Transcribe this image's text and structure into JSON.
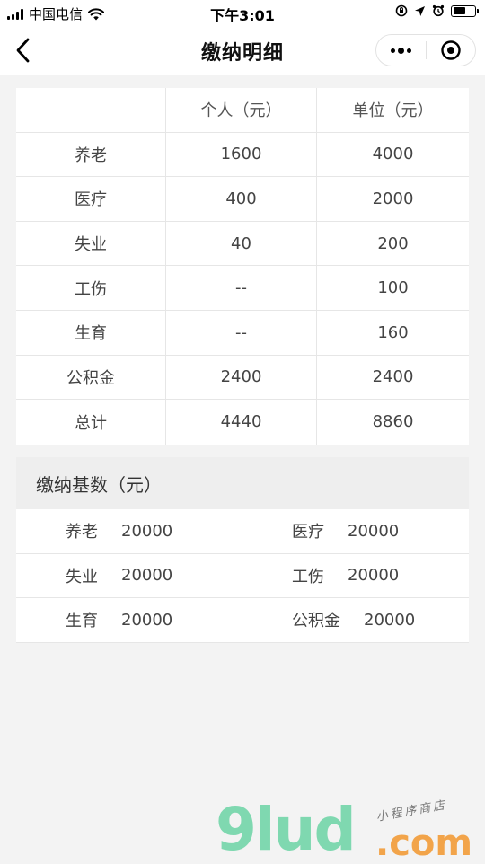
{
  "status_bar": {
    "carrier": "中国电信",
    "time": "下午3:01",
    "battery_level": 0.6
  },
  "nav": {
    "title": "缴纳明细"
  },
  "detail_table": {
    "headers": [
      "",
      "个人（元）",
      "单位（元）"
    ],
    "rows": [
      {
        "item": "养老",
        "personal": "1600",
        "company": "4000"
      },
      {
        "item": "医疗",
        "personal": "400",
        "company": "2000"
      },
      {
        "item": "失业",
        "personal": "40",
        "company": "200"
      },
      {
        "item": "工伤",
        "personal": "--",
        "company": "100"
      },
      {
        "item": "生育",
        "personal": "--",
        "company": "160"
      },
      {
        "item": "公积金",
        "personal": "2400",
        "company": "2400"
      },
      {
        "item": "总计",
        "personal": "4440",
        "company": "8860"
      }
    ]
  },
  "base": {
    "title": "缴纳基数（元）",
    "rows": [
      [
        {
          "label": "养老",
          "value": "20000"
        },
        {
          "label": "医疗",
          "value": "20000"
        }
      ],
      [
        {
          "label": "失业",
          "value": "20000"
        },
        {
          "label": "工伤",
          "value": "20000"
        }
      ],
      [
        {
          "label": "生育",
          "value": "20000"
        },
        {
          "label": "公积金",
          "value": "20000"
        }
      ]
    ]
  },
  "watermark": {
    "main": "9lud",
    "domain": ".com",
    "sub": "小程序商店"
  }
}
